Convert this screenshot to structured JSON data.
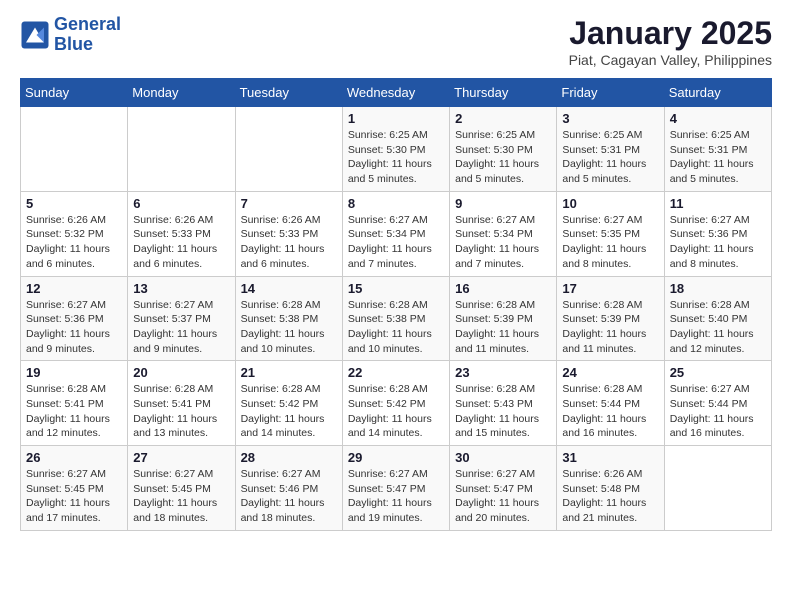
{
  "header": {
    "logo_line1": "General",
    "logo_line2": "Blue",
    "title": "January 2025",
    "subtitle": "Piat, Cagayan Valley, Philippines"
  },
  "weekdays": [
    "Sunday",
    "Monday",
    "Tuesday",
    "Wednesday",
    "Thursday",
    "Friday",
    "Saturday"
  ],
  "weeks": [
    [
      {
        "day": "",
        "sunrise": "",
        "sunset": "",
        "daylight": ""
      },
      {
        "day": "",
        "sunrise": "",
        "sunset": "",
        "daylight": ""
      },
      {
        "day": "",
        "sunrise": "",
        "sunset": "",
        "daylight": ""
      },
      {
        "day": "1",
        "sunrise": "Sunrise: 6:25 AM",
        "sunset": "Sunset: 5:30 PM",
        "daylight": "Daylight: 11 hours and 5 minutes."
      },
      {
        "day": "2",
        "sunrise": "Sunrise: 6:25 AM",
        "sunset": "Sunset: 5:30 PM",
        "daylight": "Daylight: 11 hours and 5 minutes."
      },
      {
        "day": "3",
        "sunrise": "Sunrise: 6:25 AM",
        "sunset": "Sunset: 5:31 PM",
        "daylight": "Daylight: 11 hours and 5 minutes."
      },
      {
        "day": "4",
        "sunrise": "Sunrise: 6:25 AM",
        "sunset": "Sunset: 5:31 PM",
        "daylight": "Daylight: 11 hours and 5 minutes."
      }
    ],
    [
      {
        "day": "5",
        "sunrise": "Sunrise: 6:26 AM",
        "sunset": "Sunset: 5:32 PM",
        "daylight": "Daylight: 11 hours and 6 minutes."
      },
      {
        "day": "6",
        "sunrise": "Sunrise: 6:26 AM",
        "sunset": "Sunset: 5:33 PM",
        "daylight": "Daylight: 11 hours and 6 minutes."
      },
      {
        "day": "7",
        "sunrise": "Sunrise: 6:26 AM",
        "sunset": "Sunset: 5:33 PM",
        "daylight": "Daylight: 11 hours and 6 minutes."
      },
      {
        "day": "8",
        "sunrise": "Sunrise: 6:27 AM",
        "sunset": "Sunset: 5:34 PM",
        "daylight": "Daylight: 11 hours and 7 minutes."
      },
      {
        "day": "9",
        "sunrise": "Sunrise: 6:27 AM",
        "sunset": "Sunset: 5:34 PM",
        "daylight": "Daylight: 11 hours and 7 minutes."
      },
      {
        "day": "10",
        "sunrise": "Sunrise: 6:27 AM",
        "sunset": "Sunset: 5:35 PM",
        "daylight": "Daylight: 11 hours and 8 minutes."
      },
      {
        "day": "11",
        "sunrise": "Sunrise: 6:27 AM",
        "sunset": "Sunset: 5:36 PM",
        "daylight": "Daylight: 11 hours and 8 minutes."
      }
    ],
    [
      {
        "day": "12",
        "sunrise": "Sunrise: 6:27 AM",
        "sunset": "Sunset: 5:36 PM",
        "daylight": "Daylight: 11 hours and 9 minutes."
      },
      {
        "day": "13",
        "sunrise": "Sunrise: 6:27 AM",
        "sunset": "Sunset: 5:37 PM",
        "daylight": "Daylight: 11 hours and 9 minutes."
      },
      {
        "day": "14",
        "sunrise": "Sunrise: 6:28 AM",
        "sunset": "Sunset: 5:38 PM",
        "daylight": "Daylight: 11 hours and 10 minutes."
      },
      {
        "day": "15",
        "sunrise": "Sunrise: 6:28 AM",
        "sunset": "Sunset: 5:38 PM",
        "daylight": "Daylight: 11 hours and 10 minutes."
      },
      {
        "day": "16",
        "sunrise": "Sunrise: 6:28 AM",
        "sunset": "Sunset: 5:39 PM",
        "daylight": "Daylight: 11 hours and 11 minutes."
      },
      {
        "day": "17",
        "sunrise": "Sunrise: 6:28 AM",
        "sunset": "Sunset: 5:39 PM",
        "daylight": "Daylight: 11 hours and 11 minutes."
      },
      {
        "day": "18",
        "sunrise": "Sunrise: 6:28 AM",
        "sunset": "Sunset: 5:40 PM",
        "daylight": "Daylight: 11 hours and 12 minutes."
      }
    ],
    [
      {
        "day": "19",
        "sunrise": "Sunrise: 6:28 AM",
        "sunset": "Sunset: 5:41 PM",
        "daylight": "Daylight: 11 hours and 12 minutes."
      },
      {
        "day": "20",
        "sunrise": "Sunrise: 6:28 AM",
        "sunset": "Sunset: 5:41 PM",
        "daylight": "Daylight: 11 hours and 13 minutes."
      },
      {
        "day": "21",
        "sunrise": "Sunrise: 6:28 AM",
        "sunset": "Sunset: 5:42 PM",
        "daylight": "Daylight: 11 hours and 14 minutes."
      },
      {
        "day": "22",
        "sunrise": "Sunrise: 6:28 AM",
        "sunset": "Sunset: 5:42 PM",
        "daylight": "Daylight: 11 hours and 14 minutes."
      },
      {
        "day": "23",
        "sunrise": "Sunrise: 6:28 AM",
        "sunset": "Sunset: 5:43 PM",
        "daylight": "Daylight: 11 hours and 15 minutes."
      },
      {
        "day": "24",
        "sunrise": "Sunrise: 6:28 AM",
        "sunset": "Sunset: 5:44 PM",
        "daylight": "Daylight: 11 hours and 16 minutes."
      },
      {
        "day": "25",
        "sunrise": "Sunrise: 6:27 AM",
        "sunset": "Sunset: 5:44 PM",
        "daylight": "Daylight: 11 hours and 16 minutes."
      }
    ],
    [
      {
        "day": "26",
        "sunrise": "Sunrise: 6:27 AM",
        "sunset": "Sunset: 5:45 PM",
        "daylight": "Daylight: 11 hours and 17 minutes."
      },
      {
        "day": "27",
        "sunrise": "Sunrise: 6:27 AM",
        "sunset": "Sunset: 5:45 PM",
        "daylight": "Daylight: 11 hours and 18 minutes."
      },
      {
        "day": "28",
        "sunrise": "Sunrise: 6:27 AM",
        "sunset": "Sunset: 5:46 PM",
        "daylight": "Daylight: 11 hours and 18 minutes."
      },
      {
        "day": "29",
        "sunrise": "Sunrise: 6:27 AM",
        "sunset": "Sunset: 5:47 PM",
        "daylight": "Daylight: 11 hours and 19 minutes."
      },
      {
        "day": "30",
        "sunrise": "Sunrise: 6:27 AM",
        "sunset": "Sunset: 5:47 PM",
        "daylight": "Daylight: 11 hours and 20 minutes."
      },
      {
        "day": "31",
        "sunrise": "Sunrise: 6:26 AM",
        "sunset": "Sunset: 5:48 PM",
        "daylight": "Daylight: 11 hours and 21 minutes."
      },
      {
        "day": "",
        "sunrise": "",
        "sunset": "",
        "daylight": ""
      }
    ]
  ]
}
